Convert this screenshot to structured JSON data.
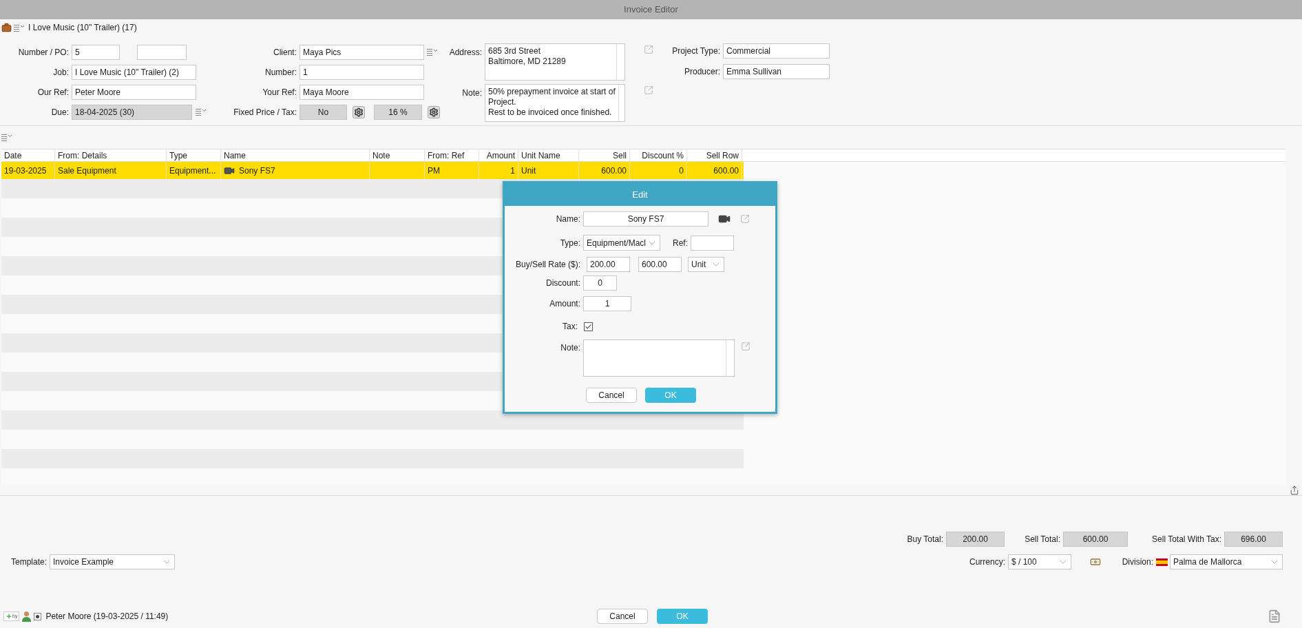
{
  "window": {
    "title": "Invoice Editor"
  },
  "project": {
    "title": "I Love Music (10\" Trailer) (17)"
  },
  "form": {
    "number_po": {
      "label": "Number / PO:",
      "value": "5"
    },
    "job": {
      "label": "Job:",
      "value": "I Love Music (10\" Trailer) (2)"
    },
    "our_ref": {
      "label": "Our Ref:",
      "value": "Peter Moore"
    },
    "due": {
      "label": "Due:",
      "value": "18-04-2025 (30)",
      "readonly": true
    },
    "client": {
      "label": "Client:",
      "value": "Maya Pics"
    },
    "number": {
      "label": "Number:",
      "value": "1"
    },
    "your_ref": {
      "label": "Your Ref:",
      "value": "Maya Moore"
    },
    "fixed_price_tax": {
      "label": "Fixed Price / Tax:",
      "fixed_price": {
        "value": "No",
        "readonly": true
      },
      "tax": {
        "value": "16 %",
        "readonly": true
      }
    },
    "address": {
      "label": "Address:",
      "lines": [
        "685 3rd Street",
        "Baltimore, MD 21289"
      ]
    },
    "note": {
      "label": "Note:",
      "lines": [
        "50% prepayment invoice at start of",
        "Project.",
        "Rest to be invoiced once finished."
      ]
    },
    "project_type": {
      "label": "Project Type:",
      "value": "Commercial"
    },
    "producer": {
      "label": "Producer:",
      "value": "Emma Sullivan"
    }
  },
  "table": {
    "columns": [
      {
        "label": "Date",
        "kind": "text"
      },
      {
        "label": "From: Details",
        "kind": "text"
      },
      {
        "label": "Type",
        "kind": "text"
      },
      {
        "label": "Name",
        "kind": "item"
      },
      {
        "label": "Note",
        "kind": "text"
      },
      {
        "label": "From: Ref",
        "kind": "text"
      },
      {
        "label": "Amount",
        "kind": "number"
      },
      {
        "label": "Unit Name",
        "kind": "text"
      },
      {
        "label": "Sell",
        "kind": "number"
      },
      {
        "label": "Discount %",
        "kind": "number"
      },
      {
        "label": "Sell Row",
        "kind": "number"
      }
    ],
    "rows": [
      {
        "selected": true,
        "cells": [
          "19-03-2025",
          "Sale Equipment",
          "Equipment...",
          "Sony FS7",
          null,
          "PM",
          "1",
          "Unit",
          "600.00",
          "0",
          "600.00"
        ]
      }
    ]
  },
  "edit_dialog": {
    "title": "Edit",
    "name": {
      "label": "Name:",
      "value": "Sony FS7"
    },
    "type": {
      "label": "Type:",
      "value": "Equipment/Macl"
    },
    "ref": {
      "label": "Ref:"
    },
    "rate": {
      "label": "Buy/Sell Rate ($):",
      "buy": "200.00",
      "sell": "600.00",
      "unit": "Unit"
    },
    "discount": {
      "label": "Discount:",
      "value": "0"
    },
    "amount": {
      "label": "Amount:",
      "value": "1"
    },
    "tax": {
      "label": "Tax:",
      "checked": true
    },
    "note": {
      "label": "Note:"
    },
    "buttons": [
      {
        "label": "Cancel",
        "primary": false
      },
      {
        "label": "OK",
        "primary": true
      }
    ]
  },
  "totals": [
    {
      "label": "Buy Total:",
      "value": "200.00",
      "readonly": true
    },
    {
      "label": "Sell Total:",
      "value": "600.00",
      "readonly": true
    },
    {
      "label": "Sell Total With Tax:",
      "value": "696.00",
      "readonly": true
    }
  ],
  "template": {
    "label": "Template:",
    "value": "Invoice Example"
  },
  "currency": {
    "label": "Currency:",
    "value": "$ / 100"
  },
  "division": {
    "label": "Division:",
    "value": "Palma de Mallorca"
  },
  "footer": {
    "badge": "by",
    "created_by": "Peter Moore (19-03-2025 / 11:49)",
    "buttons": [
      {
        "label": "Cancel",
        "primary": false
      },
      {
        "label": "OK",
        "primary": true
      }
    ]
  }
}
